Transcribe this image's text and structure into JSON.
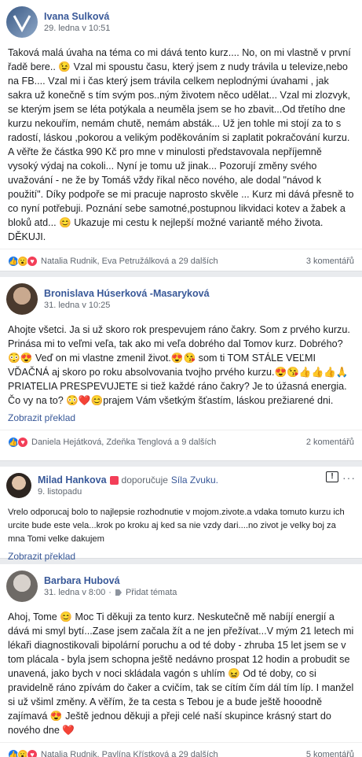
{
  "posts": [
    {
      "author": "Ivana Sulková",
      "date": "29. ledna v 10:51",
      "text": "Taková malá úvaha na téma co mi dává tento kurz.... No, on mi vlastně v první řadě bere.. 😉 Vzal mi spoustu času, který jsem z nudy trávila u televize,nebo na FB.... Vzal mi i čas který jsem trávila celkem neplodnými úvahami , jak sakra už konečně s tím svým pos..ným životem něco udělat... Vzal mi zlozvyk, se kterým jsem se léta potýkala a neuměla jsem se ho zbavit...Od třetího dne kurzu nekouřím, nemám chutě, nemám absták... Už jen tohle mi stojí za to s radostí, láskou ,pokorou a velikým poděkováním si zaplatit pokračování kurzu. A věřte že částka 990 Kč pro mne v minulosti představovala nepříjemně vysoký výdaj na cokoli... Nyní je tomu už jinak... Pozorují změny svého uvažování - ne že by Tomáš vždy říkal něco nového, ale dodal \"návod k použití\". Díky podpoře se mi pracuje naprosto skvěle ... Kurz mi dává přesně to co nyní potřebuji. Poznání sebe samotné,postupnou likvidaci kotev a žabek a bloků atd... 😊 Ukazuje mi cestu k nejlepší možné variantě mého života. DĚKUJI.",
      "reactions_names": "Natalia Rudnik, Eva Petružálková a 29 dalších",
      "comments": "3 komentářů"
    },
    {
      "author": "Bronislava Húserková -Masaryková",
      "date": "31. ledna v 10:25",
      "text": "Ahojte všetci. Ja si už skoro rok prespevujem ráno čakry. Som z prvého kurzu. Prinása mi to veľmi veľa, tak ako mi veľa dobrého dal Tomov kurz. Dobrého?😳😍 Veď on mi vlastne zmenil život.😍😘 som ti TOM STÁLE VEĽMI VĎAČNÁ aj skoro po roku absolvovania tvojho prvého kurzu.😍😘👍👍👍🙏 PRIATELIA PRESPEVUJETE si tiež každé ráno čakry? Je to úžasná energia. Čo vy na to? 😳❤️😊prajem Vám všetkým šťastím, láskou prežiarené dni.",
      "translate": "Zobrazit překlad",
      "reactions_names": "Daniela Hejátková, Zdeňka Tenglová a 9 dalších",
      "comments": "2 komentářů"
    },
    {
      "author": "Milad Hankova",
      "recommends": "doporučuje",
      "page": "Síla Zvuku.",
      "date": "9. listopadu",
      "text": "Vrelo odporucaj bolo to najlepsie rozhodnutie v mojom.zivote.a vdaka tomuto kurzu ich urcite bude este vela...krok po kroku aj ked sa nie vzdy dari....no zivot je velky boj za mna Tomi velke dakujem",
      "translate": "Zobrazit překlad"
    },
    {
      "author": "Barbara Hubová",
      "date": "31. ledna v 8:00",
      "tag_label": "Přidat témata",
      "text": "Ahoj, Tome 😊 Moc Ti děkuji za tento kurz. Neskutečně mě nabíjí energií a dává mi smyl bytí...Zase jsem začala žít a ne jen přežívat...V mým 21 letech mi lékaři diagnostikovali bipolární poruchu a od té doby - zhruba 15 let jsem se v tom plácala - byla jsem schopna ještě nedávno prospat 12 hodin a probudit se unavená, jako bych v noci skládala vagón s uhlím 😖 Od té doby, co si pravidelně ráno zpívám do čaker a cvičím, tak se cítím čím dál tím líp. I manžel si už všiml změny. A věřím, že ta cesta s Tebou je a bude ještě hooodně zajímavá 😍 Ještě jednou děkuji a přeji celé naší skupince krásný start do nového dne ❤️",
      "reactions_names": "Natalia Rudnik, Pavlína Křístková a 29 dalších",
      "comments": "5 komentářů"
    }
  ],
  "colors": {
    "link": "#385898",
    "like": "#1877f2",
    "love": "#f33e58",
    "wow": "#f7b125"
  }
}
